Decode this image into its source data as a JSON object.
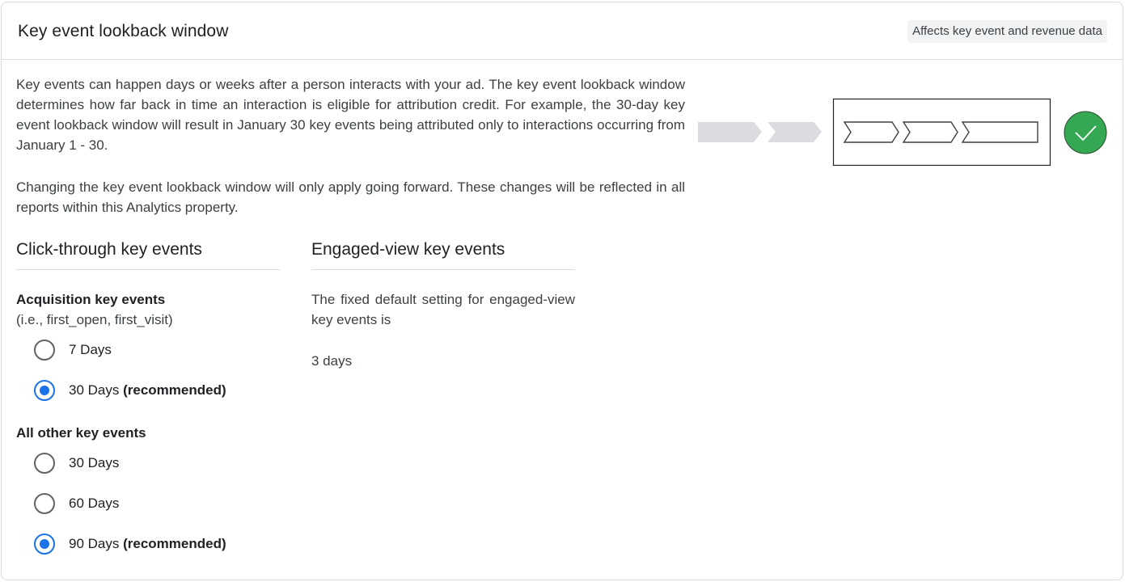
{
  "card": {
    "title": "Key event lookback window",
    "badge": "Affects key event and revenue data",
    "description": [
      "Key events can happen days or weeks after a person interacts with your ad. The key event lookback window determines how far back in time an interaction is eligible for attribution credit. For example, the 30-day key event lookback window will result in January 30 key events being attributed only to interactions occurring from January 1 - 30.",
      "Changing the key event lookback window will only apply going forward. These changes will be reflected in all reports within this Analytics property."
    ],
    "illustration": {
      "icons": [
        "chevron-step-gray",
        "chevron-step-gray",
        "lookback-window-box",
        "green-check-icon"
      ],
      "colors": {
        "inactive_step": "#dadce0",
        "check_bg": "#34a853",
        "outline": "#3c4043"
      }
    }
  },
  "click_through": {
    "heading": "Click-through key events",
    "acquisition": {
      "title": "Acquisition key events",
      "subtitle": "(i.e., first_open, first_visit)",
      "options": [
        {
          "label": "7 Days",
          "recommended": "",
          "checked": false
        },
        {
          "label": "30 Days",
          "recommended": "(recommended)",
          "checked": true
        }
      ]
    },
    "other": {
      "title": "All other key events",
      "options": [
        {
          "label": "30 Days",
          "recommended": "",
          "checked": false
        },
        {
          "label": "60 Days",
          "recommended": "",
          "checked": false
        },
        {
          "label": "90 Days",
          "recommended": "(recommended)",
          "checked": true
        }
      ]
    }
  },
  "engaged_view": {
    "heading": "Engaged-view key events",
    "text": "The fixed default setting for engaged-view key events is",
    "value": "3 days"
  },
  "colors": {
    "accent": "#1a73e8",
    "success": "#34a853",
    "border": "#dadce0",
    "badge_bg": "#f1f3f4"
  }
}
